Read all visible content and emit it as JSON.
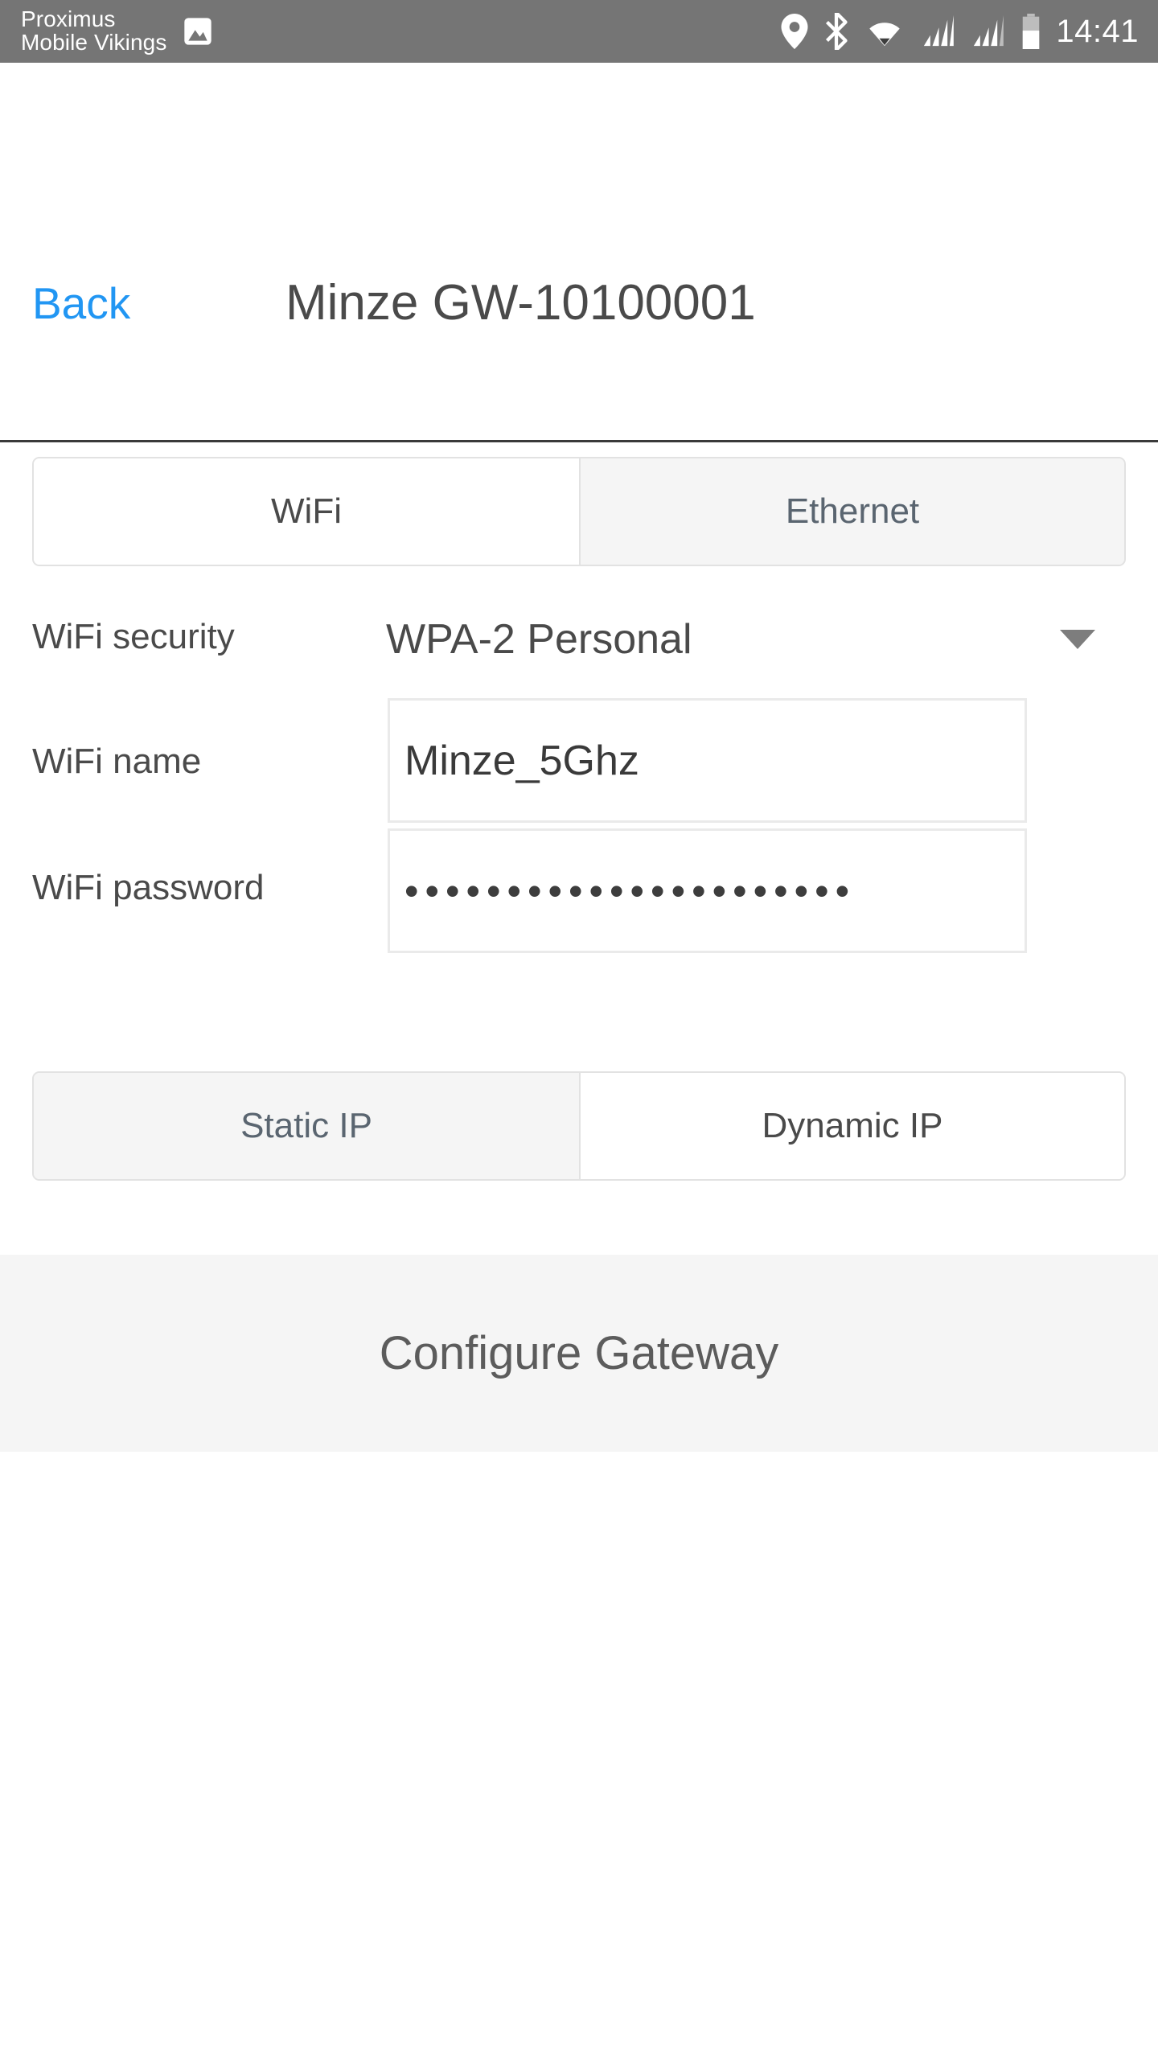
{
  "status_bar": {
    "carrier_line1": "Proximus",
    "carrier_line2": "Mobile Vikings",
    "carrier_icon": "image-icon",
    "icons": [
      "location-pin-icon",
      "bluetooth-icon",
      "wifi-icon",
      "signal-bars-icon",
      "signal-bars-2-icon",
      "battery-icon"
    ],
    "time": "14:41",
    "background_color": "#757575"
  },
  "navbar": {
    "back_label": "Back",
    "back_color": "#2196f3",
    "title": "Minze GW-10100001",
    "title_color": "#4a4a4a"
  },
  "network_tabs": {
    "items": [
      {
        "label": "WiFi",
        "selected": true
      },
      {
        "label": "Ethernet",
        "selected": false
      }
    ]
  },
  "form": {
    "security": {
      "label": "WiFi security",
      "value": "WPA-2 Personal",
      "caret_icon": "chevron-down-icon"
    },
    "name": {
      "label": "WiFi name",
      "value": "Minze_5Ghz",
      "placeholder": "WiFi name"
    },
    "password": {
      "label": "WiFi password",
      "value": "••••••••••••••••••••••",
      "placeholder": "WiFi password"
    }
  },
  "ip_tabs": {
    "items": [
      {
        "label": "Static IP",
        "selected": false
      },
      {
        "label": "Dynamic IP",
        "selected": true
      }
    ]
  },
  "primary_action": {
    "label": "Configure Gateway",
    "background_color": "#f5f5f5",
    "text_color": "#5c5c5c"
  }
}
